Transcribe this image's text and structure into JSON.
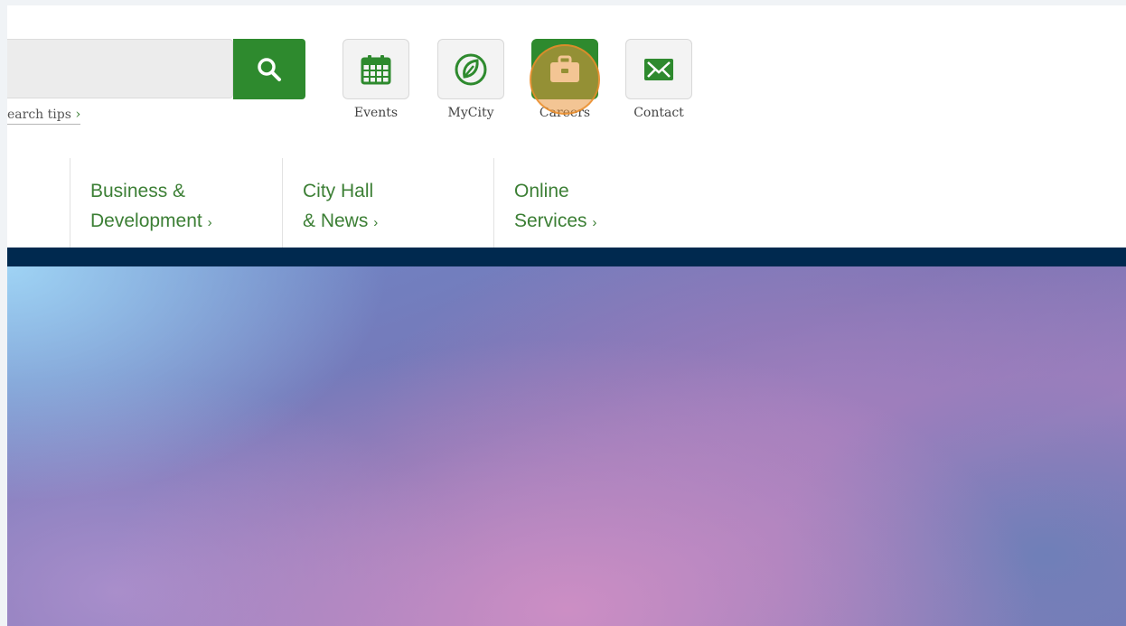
{
  "search": {
    "tips_label": "earch tips",
    "tips_chevron": "›"
  },
  "quick_links": [
    {
      "label": "Events",
      "icon": "calendar-icon"
    },
    {
      "label": "MyCity",
      "icon": "leaf-icon"
    },
    {
      "label": "Careers",
      "icon": "briefcase-icon",
      "active": true
    },
    {
      "label": "Contact",
      "icon": "envelope-icon"
    }
  ],
  "nav": [
    {
      "line1": "Business &",
      "line2": "Development",
      "chevron": "›"
    },
    {
      "line1": "City Hall",
      "line2": "& News",
      "chevron": "›"
    },
    {
      "line1": "Online",
      "line2": "Services",
      "chevron": "›"
    }
  ],
  "colors": {
    "brand_green": "#2e8a2e",
    "nav_text": "#3c7f35",
    "nav_bar": "#00294f"
  }
}
